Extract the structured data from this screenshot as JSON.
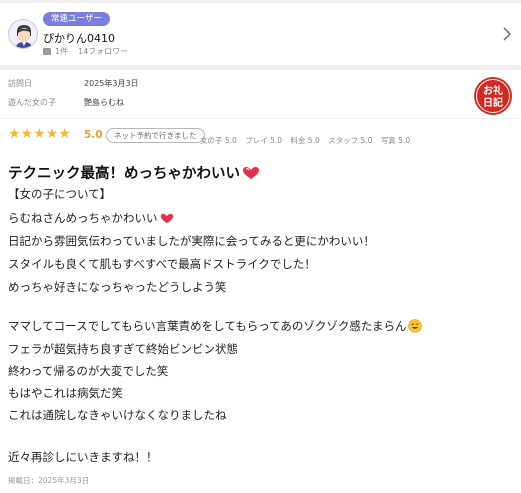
{
  "user": {
    "badge": "常連ユーザー",
    "name": "ぴかりん0410",
    "reviews_count": "1件",
    "followers": "14フォロワー",
    "icons": {
      "avatar": "avatar",
      "message": "message-icon",
      "chevron": "chevron-right-icon"
    }
  },
  "visit": {
    "date_label": "訪問日",
    "date_value": "2025年3月3日",
    "girl_label": "遊んだ女の子",
    "girl_value": "艶島らむね",
    "stamp_text": [
      "お礼",
      "日記"
    ]
  },
  "rating": {
    "overall": 5,
    "max": 5,
    "score_text": "5.0",
    "net_badge": "ネット予約で行きました",
    "sub_scores": [
      "女の子 5.0",
      "プレイ 5.0",
      "料金 5.0",
      "スタッフ 5.0",
      "写真 5.0"
    ]
  },
  "review": {
    "title": "テクニック最高！めっちゃかわいい",
    "lines": [
      "【女の子について】",
      "らむねさんめっちゃかわいい",
      "日記から雰囲気伝わっていましたが実際に会ってみると更にかわいい！",
      "スタイルも良くて肌もすべすべで最高ドストライクでした！",
      "めっちゃ好きになっちゃったどうしよう笑",
      "ママしてコースでしてもらい言葉責めをしてもらってあのゾクゾク感たまらん",
      "フェラが超気持ち良すぎて終始ビンビン状態",
      "終わって帰るのが大変でした笑",
      "もはやこれは病気だ笑",
      "これは通院しなきゃいけなくなりましたね",
      "近々再診しにいきますね！！"
    ],
    "posted": "掲載日：2025年3月3日"
  },
  "colors": {
    "badge_bg": "#7c7fd9",
    "star": "#f3b63f",
    "score": "#e4a22e",
    "stamp": "#d5261f",
    "heart": "#e0334b"
  }
}
